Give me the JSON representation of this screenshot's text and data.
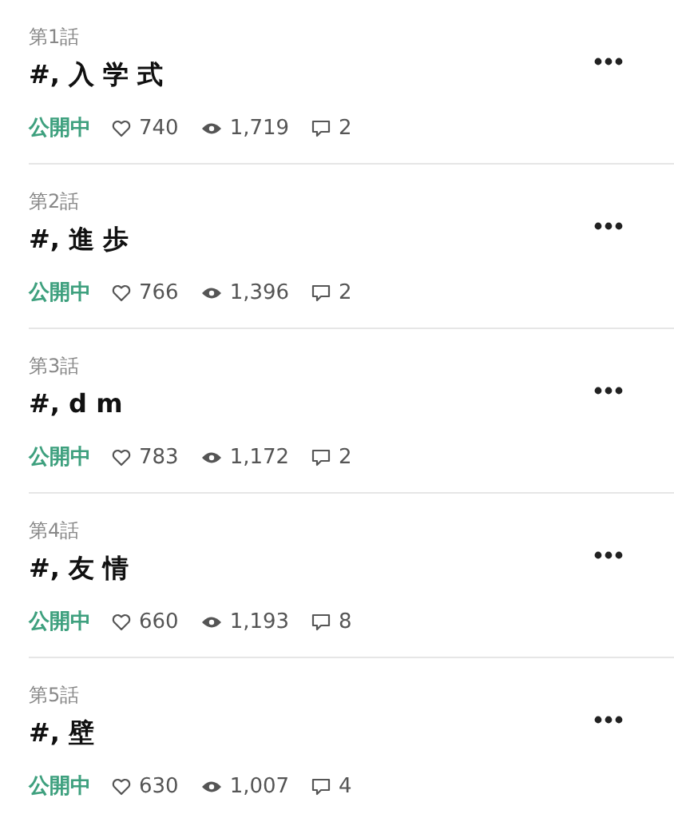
{
  "episodes": [
    {
      "number": "第1話",
      "title": "#, 入 学 式",
      "status": "公開中",
      "likes": "740",
      "views": "1,719",
      "comments": "2"
    },
    {
      "number": "第2話",
      "title": "#, 進 歩",
      "status": "公開中",
      "likes": "766",
      "views": "1,396",
      "comments": "2"
    },
    {
      "number": "第3話",
      "title": "#, d m",
      "status": "公開中",
      "likes": "783",
      "views": "1,172",
      "comments": "2"
    },
    {
      "number": "第4話",
      "title": "#, 友 情",
      "status": "公開中",
      "likes": "660",
      "views": "1,193",
      "comments": "8"
    },
    {
      "number": "第5話",
      "title": "#, 壁",
      "status": "公開中",
      "likes": "630",
      "views": "1,007",
      "comments": "4"
    }
  ]
}
